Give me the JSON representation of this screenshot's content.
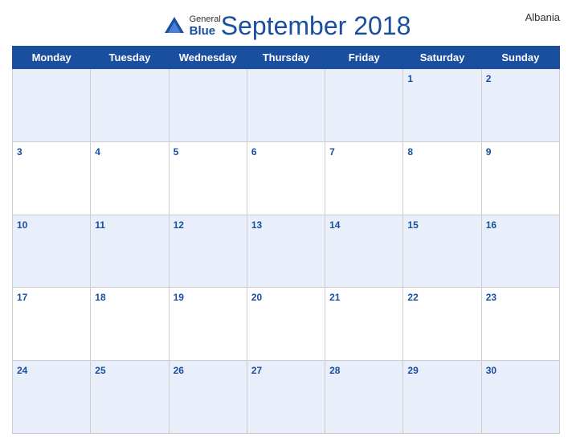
{
  "header": {
    "title": "September 2018",
    "country": "Albania",
    "logo_general": "General",
    "logo_blue": "Blue"
  },
  "weekdays": [
    "Monday",
    "Tuesday",
    "Wednesday",
    "Thursday",
    "Friday",
    "Saturday",
    "Sunday"
  ],
  "weeks": [
    [
      null,
      null,
      null,
      null,
      null,
      1,
      2
    ],
    [
      3,
      4,
      5,
      6,
      7,
      8,
      9
    ],
    [
      10,
      11,
      12,
      13,
      14,
      15,
      16
    ],
    [
      17,
      18,
      19,
      20,
      21,
      22,
      23
    ],
    [
      24,
      25,
      26,
      27,
      28,
      29,
      30
    ]
  ]
}
